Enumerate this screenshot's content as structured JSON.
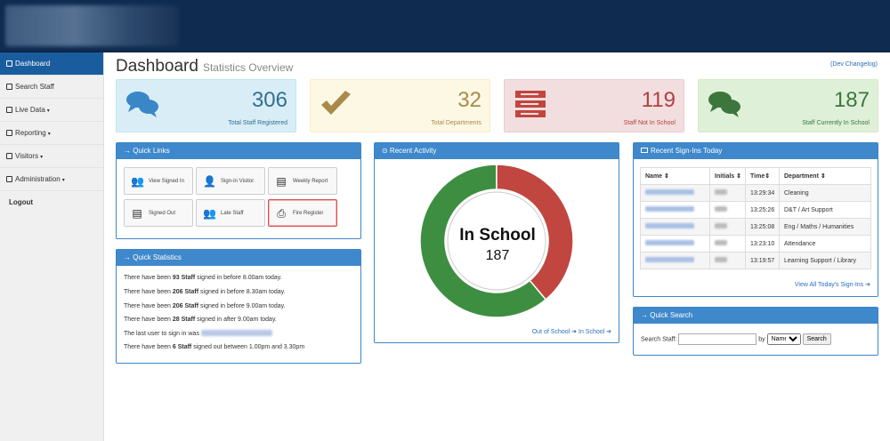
{
  "nav": {
    "items": [
      {
        "label": "Dashboard",
        "caret": ""
      },
      {
        "label": "Search Staff",
        "caret": ""
      },
      {
        "label": "Live Data",
        "caret": "▾"
      },
      {
        "label": "Reporting",
        "caret": "▾"
      },
      {
        "label": "Visitors",
        "caret": "▾"
      },
      {
        "label": "Administration",
        "caret": "▾"
      }
    ],
    "logout": "Logout"
  },
  "header": {
    "title": "Dashboard",
    "subtitle": "Statistics Overview",
    "changelog": "(Dev Changelog)"
  },
  "stats": [
    {
      "value": "306",
      "label": "Total Staff Registered",
      "icon": "comments-icon"
    },
    {
      "value": "32",
      "label": "Total Departments",
      "icon": "check-icon"
    },
    {
      "value": "119",
      "label": "Staff Not In School",
      "icon": "list-icon"
    },
    {
      "value": "187",
      "label": "Staff Currently In School",
      "icon": "comments-icon"
    }
  ],
  "quick_links": {
    "title": "→ Quick Links",
    "items": [
      "View Signed In",
      "Sign-In Visitor",
      "Weekly Report",
      "Signed Out",
      "Late Staff",
      "Fire Register"
    ]
  },
  "quick_stats": {
    "title": "→ Quick Statistics",
    "lines": [
      {
        "pre": "There have been ",
        "bold": "93 Staff",
        "post": " signed in before 8.00am today."
      },
      {
        "pre": "There have been ",
        "bold": "206 Staff",
        "post": " signed in before 8.30am today."
      },
      {
        "pre": "There have been ",
        "bold": "206 Staff",
        "post": " signed in before 9.00am today."
      },
      {
        "pre": "There have been ",
        "bold": "28 Staff",
        "post": " signed in after 9.00am today."
      },
      {
        "pre": "The last user to sign in was ",
        "bold": "",
        "post": ""
      },
      {
        "pre": "There have been ",
        "bold": "6 Staff",
        "post": " signed out between 1.00pm and 3.30pm"
      }
    ]
  },
  "activity": {
    "title": "⊙ Recent Activity",
    "center_label": "In School",
    "center_value": "187",
    "footer_out": "Out of School ➔",
    "footer_in": "In School ➔"
  },
  "chart_data": {
    "type": "pie",
    "title": "",
    "categories": [
      "In School",
      "Out of School"
    ],
    "values": [
      187,
      119
    ],
    "colors": [
      "#3e8e41",
      "#c0463f"
    ]
  },
  "signins": {
    "title": "Recent Sign-Ins Today",
    "headers": [
      "Name ⇕",
      "Initials ⇕",
      "Time⇕",
      "Department ⇕"
    ],
    "rows": [
      {
        "time": "13:29:34",
        "dept": "Cleaning"
      },
      {
        "time": "13:25:26",
        "dept": "D&T / Art Support"
      },
      {
        "time": "13:25:08",
        "dept": "Eng / Maths / Humanities"
      },
      {
        "time": "13:23:10",
        "dept": "Attendance"
      },
      {
        "time": "13:19:57",
        "dept": "Learning Support / Library"
      }
    ],
    "view_all": "View All Today's Sign-Ins ➔"
  },
  "search": {
    "title": "→ Quick Search",
    "label": "Search Staff:",
    "by": "by",
    "option": "Name",
    "button": "Search"
  }
}
